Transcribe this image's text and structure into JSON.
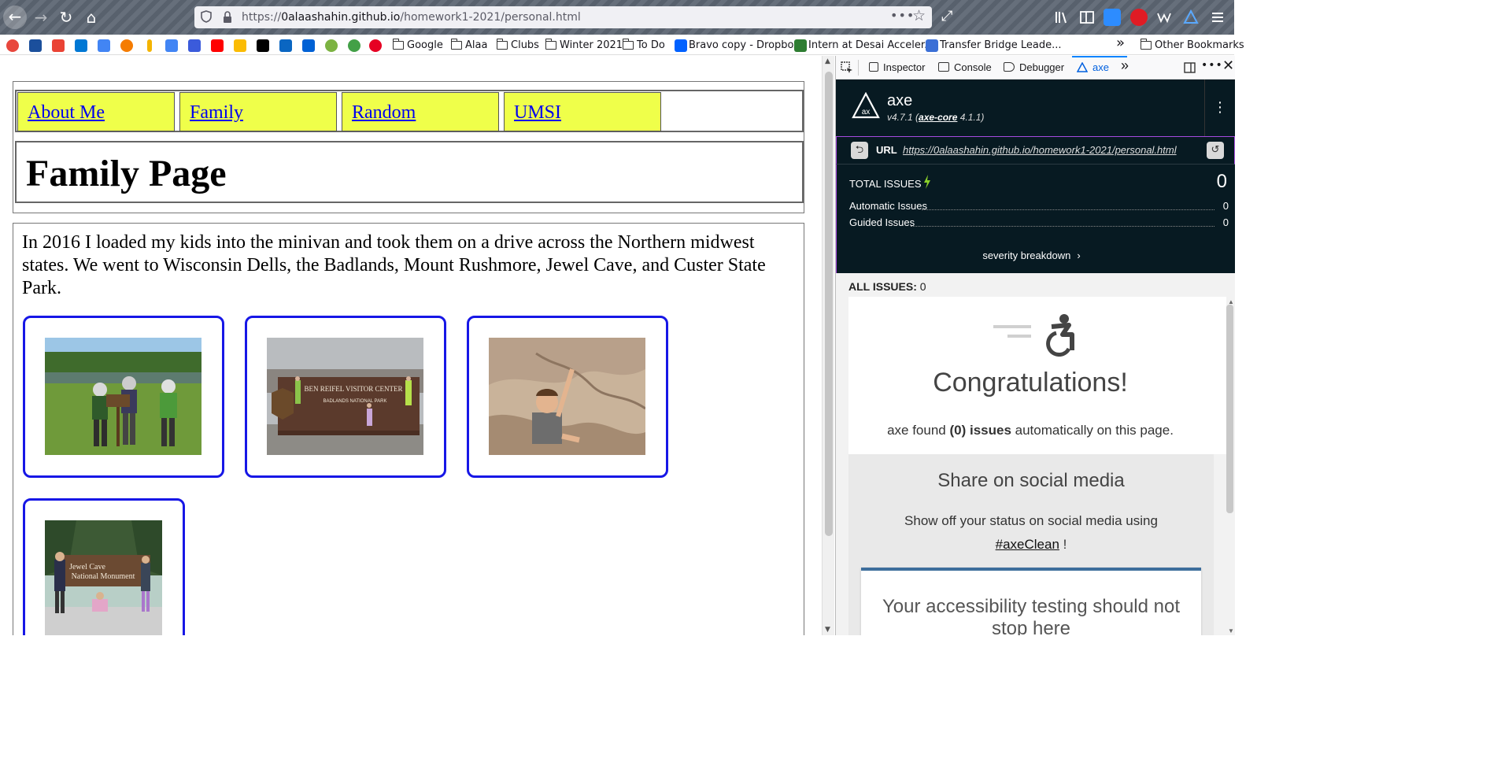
{
  "browser": {
    "url_prefix": "https://",
    "url_host": "0alaashahin.github.io",
    "url_path": "/homework1-2021/personal.html",
    "url_more": "•••",
    "back_glyph": "←",
    "forward_glyph": "→",
    "reload_glyph": "↻",
    "home_glyph": "⌂",
    "star_glyph": "☆",
    "expand_glyph": "⤢"
  },
  "bookmarks": {
    "folders": [
      "Google",
      "Alaa",
      "Clubs",
      "Winter 2021",
      "To Do"
    ],
    "links": [
      "Bravo copy - Dropbox",
      "Intern at Desai Acceler...",
      "Transfer Bridge Leade..."
    ],
    "overflow_glyph": "»",
    "other": "Other Bookmarks"
  },
  "page": {
    "nav": [
      "About Me",
      "Family",
      "Random",
      "UMSI"
    ],
    "title": "Family Page",
    "intro": "In 2016 I loaded my kids into the minivan and took them on a drive across the Northern midwest states. We went to Wisconsin Dells, the Badlands, Mount Rushmore, Jewel Cave, and Custer State Park.",
    "photos": [
      {
        "icon": "kids-outdoors-photo"
      },
      {
        "sign": "BEN REIFEL VISITOR CENTER",
        "sub": "BADLANDS NATIONAL PARK"
      },
      {
        "icon": "boy-climbing-photo"
      },
      {
        "sign": "Jewel Cave",
        "sub": "National Monument"
      }
    ]
  },
  "devtools": {
    "tabs": [
      "Inspector",
      "Console",
      "Debugger",
      "axe"
    ],
    "overflow_glyph": "»",
    "axe": {
      "name": "axe",
      "version_prefix": "v4.7.1 (",
      "version_core": "axe-core",
      "version_suffix": " 4.1.1)",
      "url_label": "URL",
      "url_value": "https://0alaashahin.github.io/homework1-2021/personal.html",
      "total_issues_label": "TOTAL ISSUES",
      "total_issues": "0",
      "automatic_label": "Automatic Issues",
      "automatic_count": "0",
      "guided_label": "Guided Issues",
      "guided_count": "0",
      "severity_link": "severity breakdown",
      "all_issues_label": "ALL ISSUES:",
      "all_issues_count": "0",
      "congrats_title": "Congratulations!",
      "congrats_pre": "axe found ",
      "congrats_bold": "(0) issues",
      "congrats_post": " automatically on this page.",
      "share_title": "Share on social media",
      "share_text": "Show off your status on social media using",
      "share_hashtag": "#axeClean",
      "share_suffix": " !",
      "promo_text": "Your accessibility testing should not stop here"
    }
  },
  "colors": {
    "nav_bg": "#efff4a",
    "link": "#0000ee",
    "photo_border": "#1717e6",
    "axe_dark": "#071a22",
    "axe_accent": "#a64be0"
  }
}
